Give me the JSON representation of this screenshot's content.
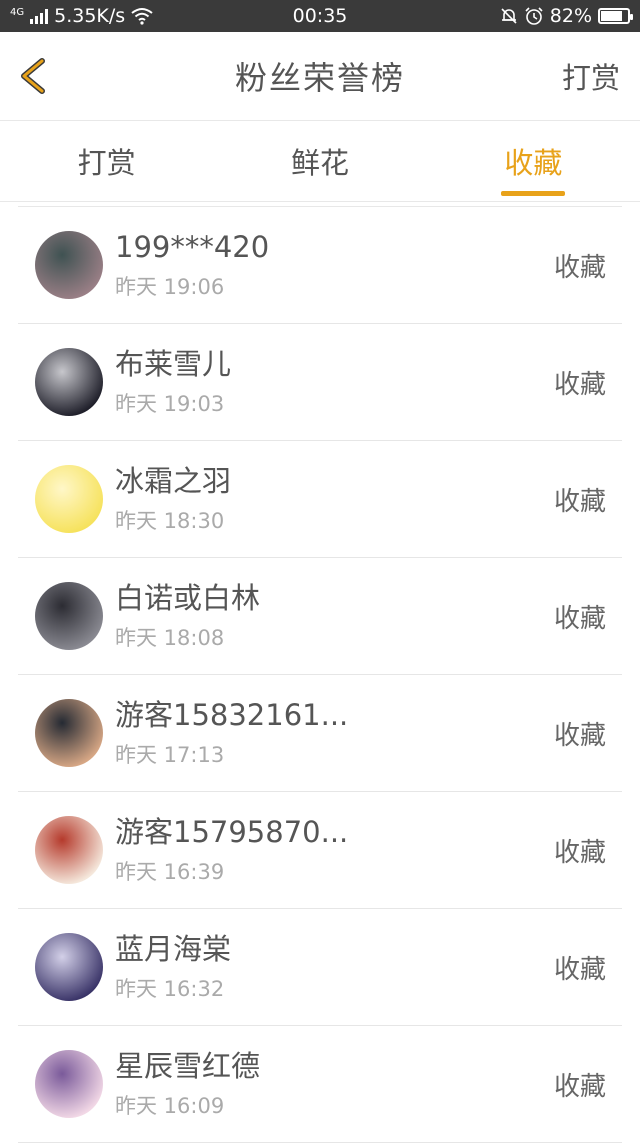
{
  "statusbar": {
    "network": "4G",
    "speed": "5.35K/s",
    "time": "00:35",
    "battery": "82%",
    "battery_level": 0.82,
    "icons": [
      "signal-icon",
      "wifi-icon",
      "mute-bell-icon",
      "alarm-icon",
      "battery-icon"
    ]
  },
  "header": {
    "title": "粉丝荣誉榜",
    "right_action": "打赏",
    "back_icon": "chevron-left-icon",
    "accent": "#e8a21a"
  },
  "tabs": [
    {
      "label": "打赏",
      "active": false
    },
    {
      "label": "鲜花",
      "active": false
    },
    {
      "label": "收藏",
      "active": true
    }
  ],
  "items": [
    {
      "name": "199***420",
      "time": "昨天 19:06",
      "action": "收藏",
      "avatar_colors": [
        "#9a7f86",
        "#3f5252"
      ]
    },
    {
      "name": "布莱雪儿",
      "time": "昨天 19:03",
      "action": "收藏",
      "avatar_colors": [
        "#1f1f2a",
        "#c7c7cc"
      ]
    },
    {
      "name": "冰霜之羽",
      "time": "昨天 18:30",
      "action": "收藏",
      "avatar_colors": [
        "#f6e25c",
        "#fff7c8"
      ]
    },
    {
      "name": "白诺或白林",
      "time": "昨天 18:08",
      "action": "收藏",
      "avatar_colors": [
        "#8a8a92",
        "#2c2c33"
      ]
    },
    {
      "name": "游客15832161...",
      "time": "昨天 17:13",
      "action": "收藏",
      "avatar_colors": [
        "#d7a785",
        "#252a33"
      ]
    },
    {
      "name": "游客15795870...",
      "time": "昨天 16:39",
      "action": "收藏",
      "avatar_colors": [
        "#f5e8dc",
        "#b53a2c"
      ]
    },
    {
      "name": "蓝月海棠",
      "time": "昨天 16:32",
      "action": "收藏",
      "avatar_colors": [
        "#3a3468",
        "#d3d0e8"
      ]
    },
    {
      "name": "星辰雪红德",
      "time": "昨天 16:09",
      "action": "收藏",
      "avatar_colors": [
        "#f2d8e6",
        "#7a5a9a"
      ]
    }
  ]
}
